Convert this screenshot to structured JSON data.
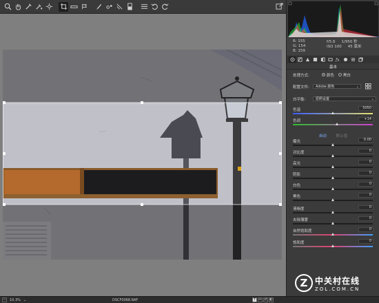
{
  "toolbar": {
    "tools": [
      "zoom",
      "hand",
      "white-balance",
      "color-sampler",
      "targeted-adjustment",
      "crop",
      "straighten",
      "spot-removal",
      "red-eye",
      "adjustment-brush",
      "graduated-filter",
      "radial-filter",
      "preferences",
      "rotate-left",
      "rotate-right"
    ],
    "active_tool": "crop"
  },
  "photo": {
    "wall_color": "#c4c4cc",
    "sky_color": "#b3b6c8",
    "window_wood_color": "#b46a2c",
    "lamp_color": "#3c3c3e"
  },
  "exif": {
    "r_label": "R:",
    "r_value": "155",
    "g_label": "G:",
    "g_value": "154",
    "b_label": "B:",
    "b_value": "159",
    "aperture": "f/5.6",
    "shutter": "1/950 秒",
    "iso": "ISO 100",
    "focal": "45 毫米"
  },
  "panel": {
    "section_title": "基本",
    "treatment_label": "处理方式:",
    "treatment_color": "颜色",
    "treatment_bw": "黑白",
    "profile_label": "配置文件:",
    "profile_value": "Adobe 颜色",
    "wb_label": "白平衡:",
    "wb_value": "原照设置",
    "auto_label": "自动",
    "default_label": "默认值"
  },
  "sliders": [
    {
      "id": "temp",
      "label": "色温",
      "value": "5050",
      "pos": 0.5
    },
    {
      "id": "tint",
      "label": "色调",
      "value": "+14",
      "pos": 0.55
    },
    {
      "id": "exposure",
      "label": "曝光",
      "value": "0.00",
      "pos": 0.5
    },
    {
      "id": "contrast",
      "label": "对比度",
      "value": "0",
      "pos": 0.5
    },
    {
      "id": "highlights",
      "label": "高光",
      "value": "0",
      "pos": 0.5
    },
    {
      "id": "shadows",
      "label": "阴影",
      "value": "0",
      "pos": 0.5
    },
    {
      "id": "whites",
      "label": "白色",
      "value": "0",
      "pos": 0.5
    },
    {
      "id": "blacks",
      "label": "黑色",
      "value": "0",
      "pos": 0.5
    },
    {
      "id": "clarity",
      "label": "清晰度",
      "value": "0",
      "pos": 0.5
    },
    {
      "id": "dehaze",
      "label": "去除薄雾",
      "value": "0",
      "pos": 0.5
    },
    {
      "id": "vibrance",
      "label": "自然饱和度",
      "value": "0",
      "pos": 0.5
    },
    {
      "id": "saturation",
      "label": "饱和度",
      "value": "0",
      "pos": 0.5
    }
  ],
  "status": {
    "zoom": "10.3%",
    "filename": "DSCF0068.RAF"
  },
  "watermark": {
    "logo_letter": "Z",
    "title": "中关村在线",
    "url": "ZOL.COM.CN"
  }
}
